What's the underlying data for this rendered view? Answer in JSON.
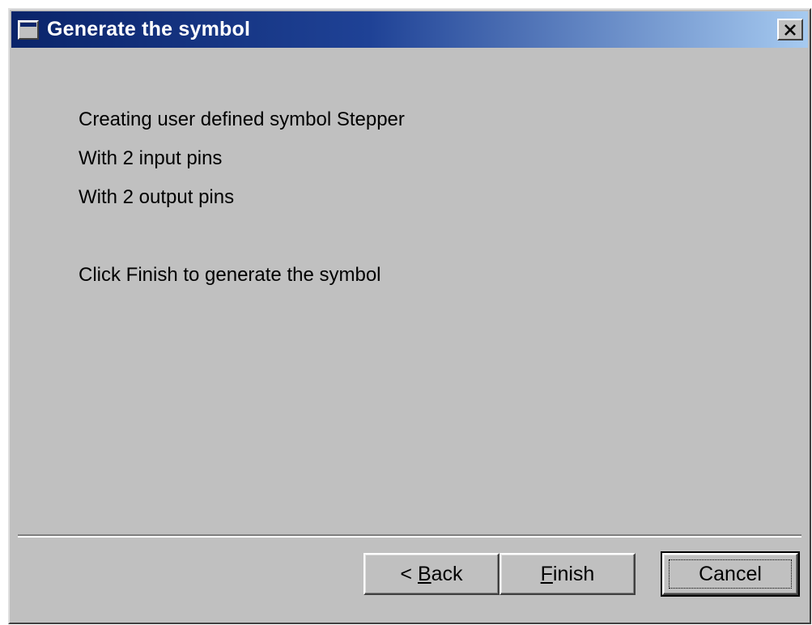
{
  "window": {
    "title": "Generate the symbol",
    "title_icon": "window-icon",
    "close_icon": "close-icon"
  },
  "message": {
    "line1": "Creating user defined symbol Stepper",
    "line2": "With 2 input pins",
    "line3": "With 2 output pins",
    "line4": "Click Finish to generate the symbol"
  },
  "buttons": {
    "back_prefix": "< ",
    "back_mnemonic": "B",
    "back_rest": "ack",
    "finish_mnemonic": "F",
    "finish_rest": "inish",
    "cancel_label": "Cancel"
  },
  "colors": {
    "titlebar_start": "#0a246a",
    "titlebar_end": "#a6caf0",
    "face": "#c0c0c0"
  }
}
